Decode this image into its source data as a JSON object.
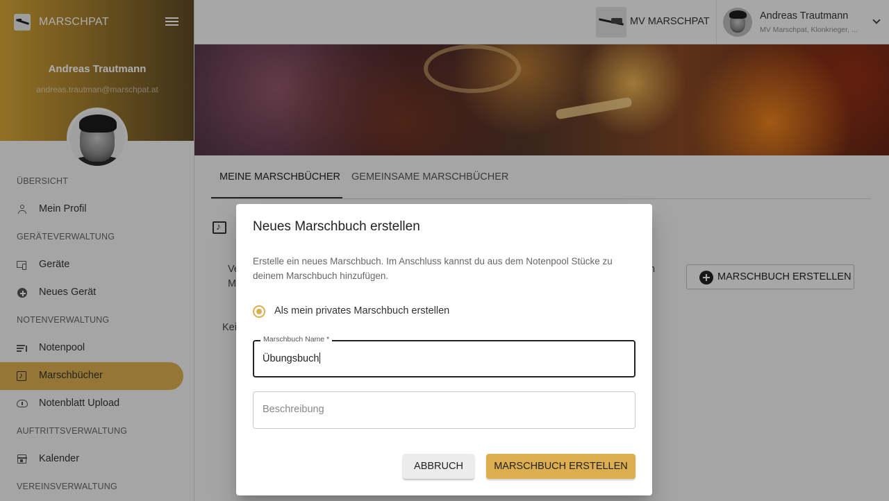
{
  "app": {
    "name": "MARSCHPAT",
    "logo_icon": "app-logo-icon",
    "menu_icon": "hamburger-icon"
  },
  "profile": {
    "name": "Andreas Trautmann",
    "email": "andreas.trautman@marschpat.at"
  },
  "nav": {
    "sections": [
      {
        "title": "ÜBERSICHT",
        "items": [
          {
            "label": "Mein Profil",
            "icon": "person-icon"
          }
        ]
      },
      {
        "title": "GERÄTEVERWALTUNG",
        "items": [
          {
            "label": "Geräte",
            "icon": "devices-icon"
          },
          {
            "label": "Neues Gerät",
            "icon": "add-circle-icon"
          }
        ]
      },
      {
        "title": "NOTENVERWALTUNG",
        "items": [
          {
            "label": "Notenpool",
            "icon": "queue-music-icon"
          },
          {
            "label": "Marschbücher",
            "icon": "music-book-icon",
            "active": true
          },
          {
            "label": "Notenblatt Upload",
            "icon": "cloud-upload-icon"
          }
        ]
      },
      {
        "title": "AUFTRITTSVERWALTUNG",
        "items": [
          {
            "label": "Kalender",
            "icon": "calendar-icon"
          }
        ]
      },
      {
        "title": "VEREINSVERWALTUNG",
        "items": []
      }
    ]
  },
  "topbar": {
    "org_name": "MV MARSCHPAT",
    "user_name": "Andreas Trautmann",
    "user_orgs": "MV Marschpat, Klonkrieger, ..."
  },
  "tabs": [
    {
      "label": "MEINE MARSCHBÜCHER",
      "active": true
    },
    {
      "label": "GEMEINSAME MARSCHBÜCHER",
      "active": false
    }
  ],
  "background": {
    "partial_1": "Ve",
    "partial_2": "M",
    "partial_3": "Kei",
    "partial_4": "n",
    "create_button": "MARSCHBUCH ERSTELLEN"
  },
  "dialog": {
    "title": "Neues Marschbuch erstellen",
    "description": "Erstelle ein neues Marschbuch. Im Anschluss kannst du aus dem Notenpool Stücke zu deinem Marschbuch hinzufügen.",
    "radio_label": "Als mein privates Marschbuch erstellen",
    "name_label": "Marschbuch Name *",
    "name_value": "Übungsbuch",
    "description_placeholder": "Beschreibung",
    "cancel_label": "ABBRUCH",
    "submit_label": "MARSCHBUCH ERSTELLEN"
  },
  "colors": {
    "accent": "#dcae4e"
  }
}
